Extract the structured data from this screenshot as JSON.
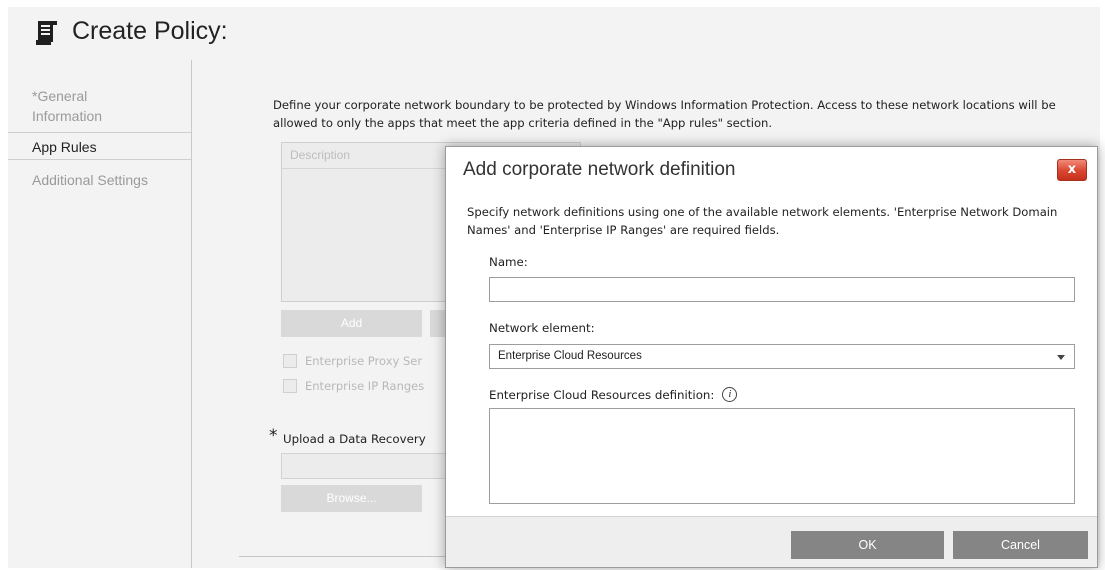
{
  "page": {
    "title": "Create Policy:",
    "title_icon": "policy-scroll-icon"
  },
  "sidebar": {
    "items": [
      {
        "label": "*General"
      },
      {
        "label": "Information"
      },
      {
        "label": "App Rules"
      },
      {
        "label": "Additional Settings"
      }
    ]
  },
  "content": {
    "intro": "Define your corporate network boundary to be protected by Windows Information Protection. Access to these network locations will be allowed to only the apps that meet the app criteria defined in the \"App rules\" section.",
    "description_header": "Description",
    "add_label": "Add",
    "checkbox_proxy": "Enterprise Proxy Ser",
    "checkbox_ip": "Enterprise IP Ranges",
    "upload_required_mark": "*",
    "upload_label": "Upload a Data Recovery",
    "browse_label": "Browse..."
  },
  "dialog": {
    "title": "Add corporate network definition",
    "close_label": "x",
    "description": "Specify network definitions using one of the available network elements. 'Enterprise Network Domain Names' and 'Enterprise IP Ranges' are required fields.",
    "name_label": "Name:",
    "name_value": "",
    "network_element_label": "Network element:",
    "network_element_value": "Enterprise Cloud Resources",
    "definition_label": "Enterprise Cloud Resources definition:",
    "info_glyph": "i",
    "ok_label": "OK",
    "cancel_label": "Cancel"
  },
  "colors": {
    "close_button": "#d9452f",
    "dialog_button": "#858585",
    "page_background": "#f3f3f3"
  }
}
